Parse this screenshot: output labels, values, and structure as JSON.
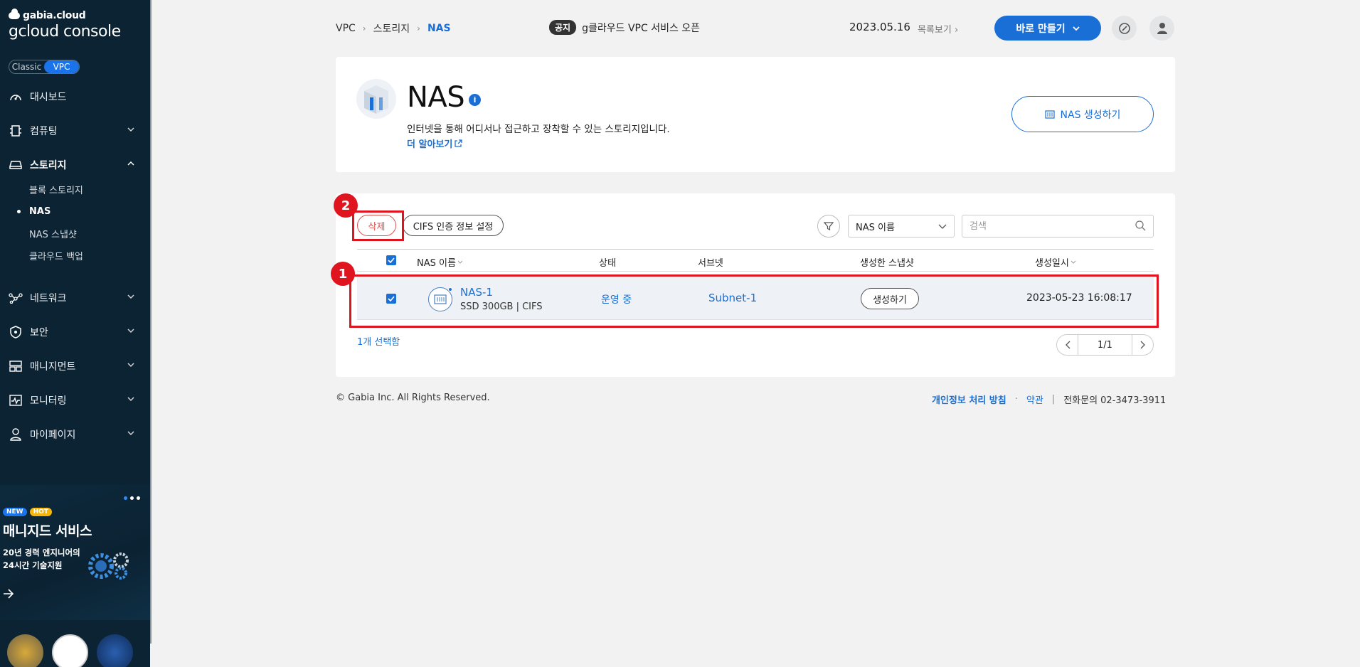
{
  "sidebar": {
    "brand_top": "gabia.cloud",
    "brand_main": "gcloud console",
    "mode_classic": "Classic",
    "mode_vpc": "VPC",
    "items": [
      {
        "label": "대시보드",
        "icon": "dashboard-icon"
      },
      {
        "label": "컴퓨팅",
        "icon": "cpu-icon"
      },
      {
        "label": "스토리지",
        "icon": "storage-icon"
      },
      {
        "label": "네트워크",
        "icon": "network-icon"
      },
      {
        "label": "보안",
        "icon": "shield-icon"
      },
      {
        "label": "매니지먼트",
        "icon": "management-icon"
      },
      {
        "label": "모니터링",
        "icon": "monitoring-icon"
      },
      {
        "label": "마이페이지",
        "icon": "user-icon"
      }
    ],
    "storage_sub": [
      "블록 스토리지",
      "NAS",
      "NAS 스냅샷",
      "클라우드 백업"
    ],
    "promo": {
      "badge_new": "NEW",
      "badge_hot": "HOT",
      "title": "매니지드 서비스",
      "sub": "20년 경력 엔지니어의 24시간 기술지원"
    }
  },
  "header": {
    "breadcrumb": [
      "VPC",
      "스토리지",
      "NAS"
    ],
    "notice_badge": "공지",
    "notice_text": "g클라우드 VPC 서비스 오픈",
    "notice_date": "2023.05.16",
    "notice_more": "목록보기",
    "create_button": "바로 만들기"
  },
  "intro": {
    "title": "NAS",
    "description": "인터넷을 통해 어디서나 접근하고 장착할 수 있는 스토리지입니다.",
    "learn_more": "더 알아보기",
    "create_button": "NAS 생성하기"
  },
  "list": {
    "delete_button": "삭제",
    "cifs_button": "CIFS 인증 정보 설정",
    "filter_select": "NAS 이름",
    "search_placeholder": "검색",
    "columns": [
      "NAS 이름",
      "상태",
      "서브넷",
      "생성한 스냅샷",
      "생성일시"
    ],
    "rows": [
      {
        "name": "NAS-1",
        "meta": "SSD 300GB  |  CIFS",
        "status": "운영 중",
        "subnet": "Subnet-1",
        "snapshot_button": "생성하기",
        "created": "2023-05-23 16:08:17",
        "selected": true
      }
    ],
    "selected_count": "1개 선택함",
    "page": "1/1"
  },
  "annotations": [
    "1",
    "2"
  ],
  "footer": {
    "copyright": "© Gabia Inc. All Rights Reserved.",
    "privacy": "개인정보 처리 방침",
    "dot": "·",
    "terms": "약관",
    "bar": "|",
    "phone": "전화문의  02-3473-3911"
  },
  "colors": {
    "sidebar_bg": "#0c2333",
    "accent": "#1a6fd6",
    "annotation": "#e0141e",
    "danger": "#d9534f"
  }
}
